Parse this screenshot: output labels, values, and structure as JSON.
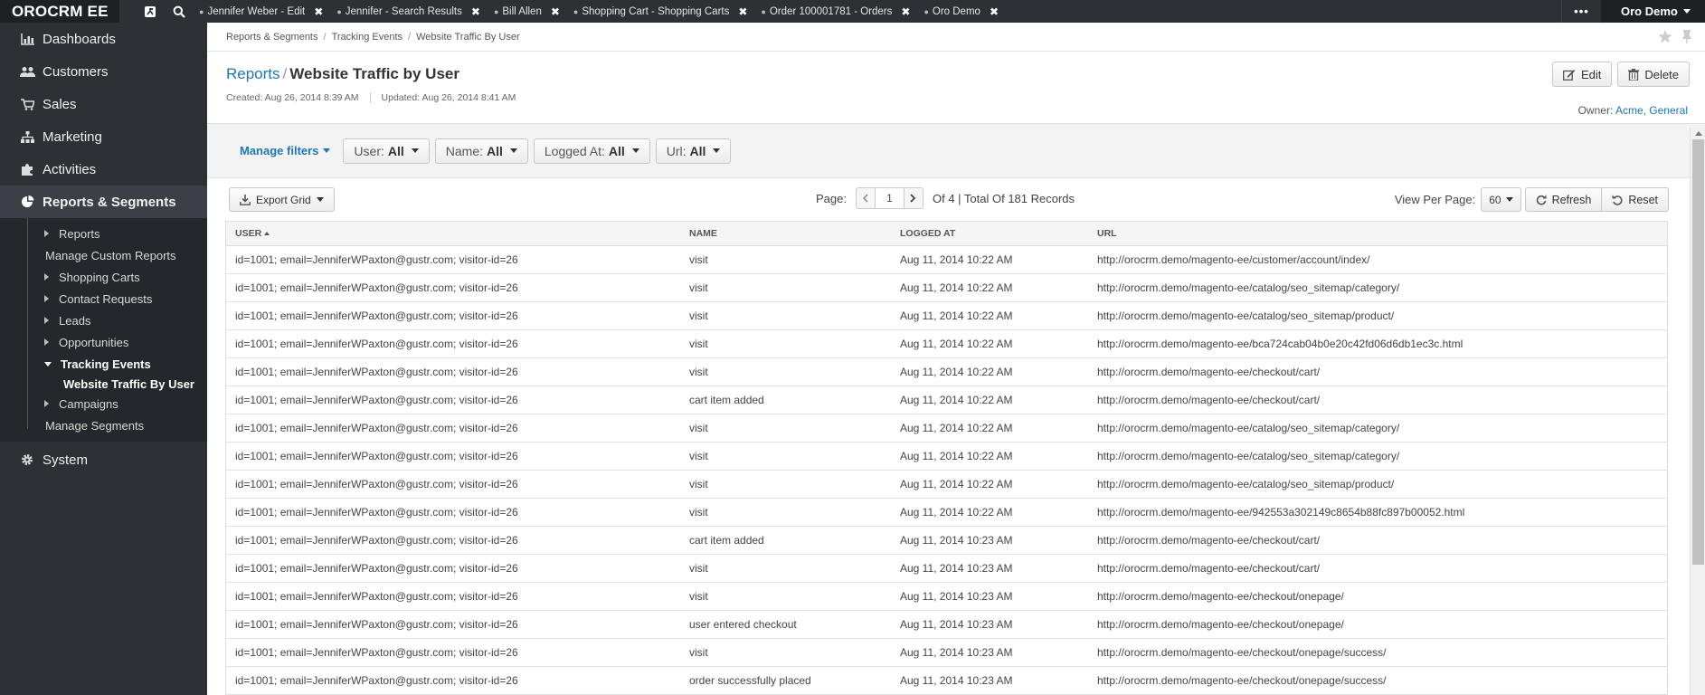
{
  "app": {
    "logo": "OROCRM EE",
    "user": "Oro Demo",
    "more": "•••"
  },
  "pinned_tabs": [
    {
      "label": "Jennifer Weber - Edit"
    },
    {
      "label": "Jennifer - Search Results"
    },
    {
      "label": "Bill Allen"
    },
    {
      "label": "Shopping Cart - Shopping Carts"
    },
    {
      "label": "Order 100001781 - Orders"
    },
    {
      "label": "Oro Demo"
    }
  ],
  "sidebar": {
    "main_items": [
      {
        "label": "Dashboards",
        "icon": "bar-chart-icon"
      },
      {
        "label": "Customers",
        "icon": "users-icon"
      },
      {
        "label": "Sales",
        "icon": "cart-icon"
      },
      {
        "label": "Marketing",
        "icon": "sitemap-icon"
      },
      {
        "label": "Activities",
        "icon": "puzzle-icon"
      },
      {
        "label": "Reports & Segments",
        "icon": "reports-icon"
      }
    ],
    "sub_items": [
      {
        "label": "Reports"
      },
      {
        "label": "Manage Custom Reports"
      },
      {
        "label": "Shopping Carts"
      },
      {
        "label": "Contact Requests"
      },
      {
        "label": "Leads"
      },
      {
        "label": "Opportunities"
      },
      {
        "label": "Tracking Events"
      },
      {
        "label": "Website Traffic By User"
      },
      {
        "label": "Campaigns"
      },
      {
        "label": "Manage Segments"
      }
    ],
    "system": {
      "label": "System",
      "icon": "gear-icon"
    }
  },
  "breadcrumb": [
    "Reports & Segments",
    "Tracking Events",
    "Website Traffic By User"
  ],
  "page": {
    "parent_link": "Reports",
    "separator": "/",
    "title": "Website Traffic by User",
    "created": "Created: Aug 26, 2014 8:39 AM",
    "updated": "Updated: Aug 26, 2014 8:41 AM",
    "edit_label": "Edit",
    "delete_label": "Delete",
    "owner_label": "Owner:",
    "owner_value": "Acme, General"
  },
  "filters": {
    "manage_label": "Manage filters",
    "items": [
      {
        "label": "User:",
        "value": "All"
      },
      {
        "label": "Name:",
        "value": "All"
      },
      {
        "label": "Logged At:",
        "value": "All"
      },
      {
        "label": "Url:",
        "value": "All"
      }
    ]
  },
  "toolbar": {
    "export_label": "Export Grid",
    "page_label": "Page:",
    "page_value": "1",
    "page_info": "Of 4 | Total Of 181 Records",
    "view_per_page_label": "View Per Page:",
    "view_per_page_value": "60",
    "refresh_label": "Refresh",
    "reset_label": "Reset"
  },
  "grid": {
    "columns": [
      "USER",
      "NAME",
      "LOGGED AT",
      "URL"
    ],
    "rows": [
      [
        "id=1001; email=JenniferWPaxton@gustr.com; visitor-id=26",
        "visit",
        "Aug 11, 2014 10:22 AM",
        "http://orocrm.demo/magento-ee/customer/account/index/"
      ],
      [
        "id=1001; email=JenniferWPaxton@gustr.com; visitor-id=26",
        "visit",
        "Aug 11, 2014 10:22 AM",
        "http://orocrm.demo/magento-ee/catalog/seo_sitemap/category/"
      ],
      [
        "id=1001; email=JenniferWPaxton@gustr.com; visitor-id=26",
        "visit",
        "Aug 11, 2014 10:22 AM",
        "http://orocrm.demo/magento-ee/catalog/seo_sitemap/product/"
      ],
      [
        "id=1001; email=JenniferWPaxton@gustr.com; visitor-id=26",
        "visit",
        "Aug 11, 2014 10:22 AM",
        "http://orocrm.demo/magento-ee/bca724cab04b0e20c42fd06d6db1ec3c.html"
      ],
      [
        "id=1001; email=JenniferWPaxton@gustr.com; visitor-id=26",
        "visit",
        "Aug 11, 2014 10:22 AM",
        "http://orocrm.demo/magento-ee/checkout/cart/"
      ],
      [
        "id=1001; email=JenniferWPaxton@gustr.com; visitor-id=26",
        "cart item added",
        "Aug 11, 2014 10:22 AM",
        "http://orocrm.demo/magento-ee/checkout/cart/"
      ],
      [
        "id=1001; email=JenniferWPaxton@gustr.com; visitor-id=26",
        "visit",
        "Aug 11, 2014 10:22 AM",
        "http://orocrm.demo/magento-ee/catalog/seo_sitemap/category/"
      ],
      [
        "id=1001; email=JenniferWPaxton@gustr.com; visitor-id=26",
        "visit",
        "Aug 11, 2014 10:22 AM",
        "http://orocrm.demo/magento-ee/catalog/seo_sitemap/category/"
      ],
      [
        "id=1001; email=JenniferWPaxton@gustr.com; visitor-id=26",
        "visit",
        "Aug 11, 2014 10:22 AM",
        "http://orocrm.demo/magento-ee/catalog/seo_sitemap/product/"
      ],
      [
        "id=1001; email=JenniferWPaxton@gustr.com; visitor-id=26",
        "visit",
        "Aug 11, 2014 10:22 AM",
        "http://orocrm.demo/magento-ee/942553a302149c8654b88fc897b00052.html"
      ],
      [
        "id=1001; email=JenniferWPaxton@gustr.com; visitor-id=26",
        "cart item added",
        "Aug 11, 2014 10:23 AM",
        "http://orocrm.demo/magento-ee/checkout/cart/"
      ],
      [
        "id=1001; email=JenniferWPaxton@gustr.com; visitor-id=26",
        "visit",
        "Aug 11, 2014 10:23 AM",
        "http://orocrm.demo/magento-ee/checkout/cart/"
      ],
      [
        "id=1001; email=JenniferWPaxton@gustr.com; visitor-id=26",
        "visit",
        "Aug 11, 2014 10:23 AM",
        "http://orocrm.demo/magento-ee/checkout/onepage/"
      ],
      [
        "id=1001; email=JenniferWPaxton@gustr.com; visitor-id=26",
        "user entered checkout",
        "Aug 11, 2014 10:23 AM",
        "http://orocrm.demo/magento-ee/checkout/onepage/"
      ],
      [
        "id=1001; email=JenniferWPaxton@gustr.com; visitor-id=26",
        "visit",
        "Aug 11, 2014 10:23 AM",
        "http://orocrm.demo/magento-ee/checkout/onepage/success/"
      ],
      [
        "id=1001; email=JenniferWPaxton@gustr.com; visitor-id=26",
        "order successfully placed",
        "Aug 11, 2014 10:23 AM",
        "http://orocrm.demo/magento-ee/checkout/onepage/success/"
      ]
    ]
  },
  "colors": {
    "link": "#1f76b6",
    "sidebar_bg": "#2d3035",
    "topbar_bg": "#2d3035"
  }
}
